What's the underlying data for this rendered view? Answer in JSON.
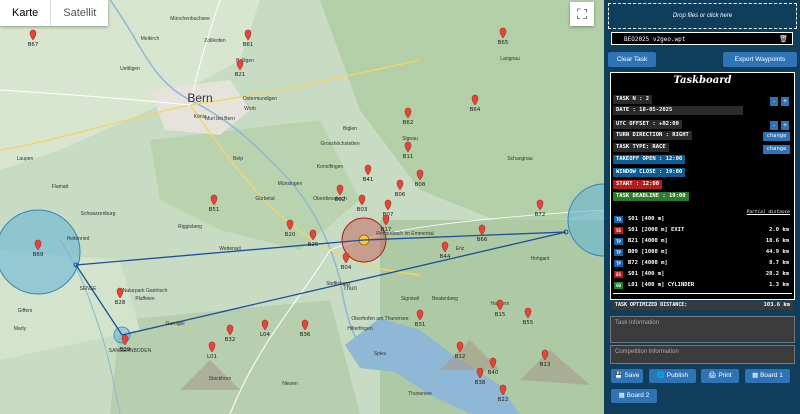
{
  "map": {
    "tabs": [
      {
        "label": "Karte"
      },
      {
        "label": "Satellit"
      }
    ],
    "fullscreen_icon": "⛶",
    "cities": [
      {
        "name": "Bern"
      },
      {
        "name": "Köniz"
      },
      {
        "name": "Worb"
      },
      {
        "name": "Belp"
      },
      {
        "name": "Münsingen"
      },
      {
        "name": "Thun"
      },
      {
        "name": "Spiez"
      },
      {
        "name": "Schwarzenburg"
      },
      {
        "name": "Riggisberg"
      },
      {
        "name": "Zollikofen"
      },
      {
        "name": "Bolligen"
      },
      {
        "name": "Steffisburg"
      },
      {
        "name": "Oberdiessbach"
      },
      {
        "name": "Konolfingen"
      },
      {
        "name": "Grosshöchstetten"
      },
      {
        "name": "Signau"
      },
      {
        "name": "Schangnau"
      },
      {
        "name": "Oberhofen am Thunersee"
      },
      {
        "name": "Hilterfingen"
      },
      {
        "name": "Sigriswil"
      },
      {
        "name": "Heitenried"
      },
      {
        "name": "Plaffeien"
      },
      {
        "name": "Giffers"
      },
      {
        "name": "Marly"
      },
      {
        "name": "Flamatt"
      },
      {
        "name": "Laupen"
      },
      {
        "name": "Münchenbuchsee"
      },
      {
        "name": "Meikirch"
      },
      {
        "name": "Uettligen"
      },
      {
        "name": "Ostermundigen"
      },
      {
        "name": "Muri bei Bern"
      },
      {
        "name": "Gürbetal"
      },
      {
        "name": "Wattenwil"
      },
      {
        "name": "Gurnigel"
      },
      {
        "name": "Stockhorn"
      },
      {
        "name": "Niesen"
      },
      {
        "name": "Beatenberg"
      },
      {
        "name": "Thunersee"
      },
      {
        "name": "Habkern"
      },
      {
        "name": "Eriz"
      },
      {
        "name": "Röthenbach im Emmental"
      },
      {
        "name": "Biglen"
      },
      {
        "name": "Langnau"
      },
      {
        "name": "Naturpark Gantrisch"
      },
      {
        "name": "Hohgant"
      },
      {
        "name": "SANGERNBODEN"
      },
      {
        "name": "SENSE"
      }
    ],
    "waypoints": [
      {
        "name": "B67"
      },
      {
        "name": "B61"
      },
      {
        "name": "B62"
      },
      {
        "name": "B65"
      },
      {
        "name": "B64"
      },
      {
        "name": "B21"
      },
      {
        "name": "B11"
      },
      {
        "name": "B41"
      },
      {
        "name": "B51"
      },
      {
        "name": "B02"
      },
      {
        "name": "B03"
      },
      {
        "name": "B07"
      },
      {
        "name": "B17"
      },
      {
        "name": "B25"
      },
      {
        "name": "B20"
      },
      {
        "name": "B04"
      },
      {
        "name": "B06"
      },
      {
        "name": "B08"
      },
      {
        "name": "B66"
      },
      {
        "name": "B72"
      },
      {
        "name": "B69"
      },
      {
        "name": "B28"
      },
      {
        "name": "B29"
      },
      {
        "name": "L04"
      },
      {
        "name": "B31"
      },
      {
        "name": "B15"
      },
      {
        "name": "B12"
      },
      {
        "name": "B22"
      },
      {
        "name": "B55"
      },
      {
        "name": "B40"
      },
      {
        "name": "B44"
      },
      {
        "name": "B13"
      },
      {
        "name": "B36"
      },
      {
        "name": "B32"
      },
      {
        "name": "B38"
      },
      {
        "name": "L01"
      }
    ]
  },
  "panel": {
    "drop_label": "Drop files or click here",
    "file_name": "BEO2025 v2geo.wpt",
    "trash_icon": "🗑",
    "clear_task_label": "Clear Task",
    "export_label": "Export Waypoints",
    "taskboard": {
      "title": "Taskboard",
      "task_n": "TASK N : 2",
      "date": "DATE : 18-05-2025",
      "utc": "UTC OFFSET : +02:00",
      "turn": "TURN DIRECTION : RIGHT",
      "type": "TASK TYPE: RACE",
      "takeoff": "TAKEOFF OPEN : 12:00",
      "window": "WINDOW CLOSE : 19:00",
      "start": "START : 12:00",
      "deadline": "TASK DEADLINE : 19:00",
      "minus": "-",
      "plus": "+",
      "change": "change",
      "partial_label": "Partial distance",
      "turnpoints": [
        {
          "badge": "TO",
          "color": "#1e63a8",
          "name": "S01 [400 m]",
          "dist": ""
        },
        {
          "badge": "SS",
          "color": "#b51d1d",
          "name": "S01 [2000 m] EXIT",
          "dist": "2.0 km"
        },
        {
          "badge": "TP",
          "color": "#1e63a8",
          "name": "B21 [4000 m]",
          "dist": "18.6 km"
        },
        {
          "badge": "TP",
          "color": "#1e63a8",
          "name": "B09 [1000 m]",
          "dist": "44.9 km"
        },
        {
          "badge": "TP",
          "color": "#1e63a8",
          "name": "B72 [4000 m]",
          "dist": "8.7 km"
        },
        {
          "badge": "ES",
          "color": "#b51d1d",
          "name": "S01 [400 m]",
          "dist": "28.2 km"
        },
        {
          "badge": "GO",
          "color": "#2f7a2f",
          "name": "L01 [400 m] CYLINDER",
          "dist": "1.3 km"
        }
      ],
      "optimized_label": "TASK OPTIMIZED DISTANCE:",
      "optimized_value": "103.6 km"
    },
    "task_info_placeholder": "Task Information",
    "competition_placeholder": "Competition Information",
    "buttons": {
      "save": "Save",
      "publish": "Publish",
      "print": "Print",
      "board1": "Board 1",
      "board2": "Board 2"
    }
  }
}
